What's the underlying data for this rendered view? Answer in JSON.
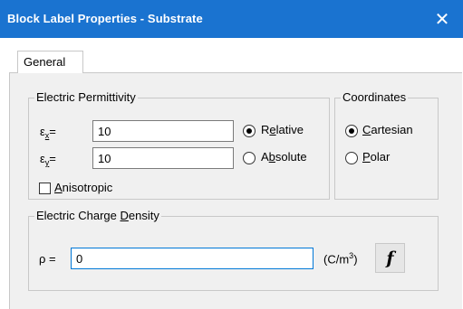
{
  "window": {
    "title": "Block Label Properties - Substrate",
    "close_glyph": "✕"
  },
  "tabs": [
    {
      "label": "General",
      "selected": true
    }
  ],
  "permittivity": {
    "legend": "Electric Permittivity",
    "ex_label": "ε",
    "ex_sub": "x",
    "ex_eq": "=",
    "ex_value": "10",
    "ey_label": "ε",
    "ey_sub": "y",
    "ey_eq": "=",
    "ey_value": "10",
    "relative_pre": "R",
    "relative_key": "e",
    "relative_post": "lative",
    "relative_selected": true,
    "absolute_pre": "A",
    "absolute_key": "b",
    "absolute_post": "solute",
    "absolute_selected": false,
    "anisotropic_key": "A",
    "anisotropic_post": "nisotropic",
    "anisotropic_checked": false
  },
  "coordinates": {
    "legend": "Coordinates",
    "cartesian_key": "C",
    "cartesian_post": "artesian",
    "cartesian_selected": true,
    "polar_key": "P",
    "polar_post": "olar",
    "polar_selected": false
  },
  "charge_density": {
    "legend_pre": "Electric Charge ",
    "legend_key": "D",
    "legend_post": "ensity",
    "rho_label": "ρ =",
    "value": "0",
    "unit_pre": "(C/m",
    "unit_sup": "3",
    "unit_post": ")",
    "function_button": "f"
  },
  "colors": {
    "titlebar": "#1a73d0",
    "panel": "#f0f0f0",
    "focus_border": "#0078d7"
  }
}
